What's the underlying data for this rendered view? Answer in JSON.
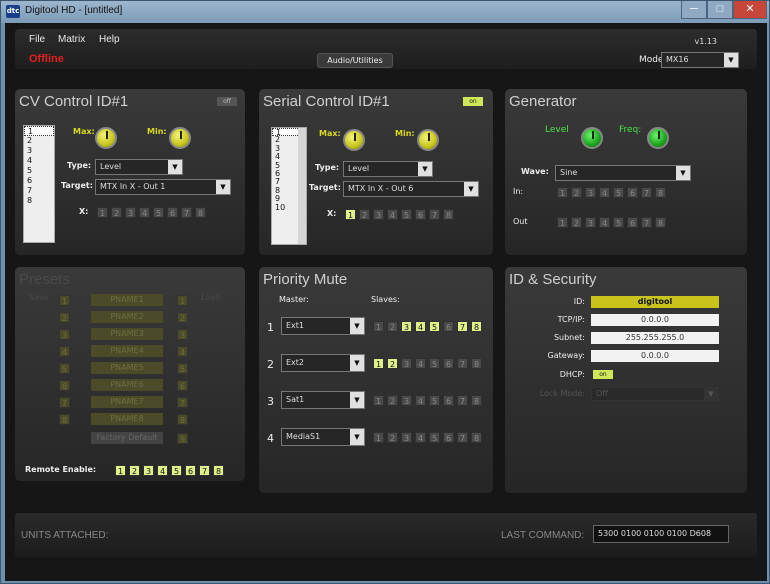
{
  "window": {
    "title": "Digitool HD - [untitled]",
    "app_icon": "dtc",
    "min": "─",
    "max": "□",
    "close": "✕"
  },
  "menu": {
    "file": "File",
    "matrix": "Matrix",
    "help": "Help",
    "version": "v1.13",
    "status": "Offline",
    "center_button": "Audio/Utilities",
    "model_label": "Model:",
    "model_value": "MX16"
  },
  "cv": {
    "title": "CV Control ID#1",
    "toggle": "off",
    "list": [
      "1",
      "2",
      "3",
      "4",
      "5",
      "6",
      "7",
      "8"
    ],
    "max": "Max:",
    "min": "Min:",
    "type_label": "Type:",
    "type_value": "Level",
    "target_label": "Target:",
    "target_value": "MTX In X - Out 1",
    "x_label": "X:",
    "x_buttons": [
      "1",
      "2",
      "3",
      "4",
      "5",
      "6",
      "7",
      "8"
    ]
  },
  "serial": {
    "title": "Serial Control ID#1",
    "toggle": "on",
    "list": [
      "1",
      "2",
      "3",
      "4",
      "5",
      "6",
      "7",
      "8",
      "9",
      "10"
    ],
    "max": "Max:",
    "min": "Min:",
    "type_label": "Type:",
    "type_value": "Level",
    "target_label": "Target:",
    "target_value": "MTX In X - Out 6",
    "x_label": "X:",
    "x_buttons": [
      "1",
      "2",
      "3",
      "4",
      "5",
      "6",
      "7",
      "8"
    ],
    "x_on": "1"
  },
  "gen": {
    "title": "Generator",
    "level": "Level",
    "freq": "Freq:",
    "wave_label": "Wave:",
    "wave_value": "Sine",
    "in_label": "In:",
    "out_label": "Out",
    "buttons": [
      "1",
      "2",
      "3",
      "4",
      "5",
      "6",
      "7",
      "8"
    ]
  },
  "presets": {
    "title": "Presets",
    "save": "Save",
    "load": "Load",
    "names": [
      "PNAME1",
      "PNAME2",
      "PNAME3",
      "PNAME4",
      "PNAME5",
      "PNAME6",
      "PNAME7",
      "PNAME8"
    ],
    "nums": [
      "1",
      "2",
      "3",
      "4",
      "5",
      "6",
      "7",
      "8"
    ],
    "factory": "Factory Default",
    "factory_num": "9",
    "remote_label": "Remote Enable:",
    "remote": [
      "1",
      "2",
      "3",
      "4",
      "5",
      "6",
      "7",
      "8"
    ]
  },
  "mute": {
    "title": "Priority Mute",
    "master": "Master:",
    "slaves": "Slaves:",
    "rows": [
      {
        "num": "1",
        "value": "Ext1",
        "on": [
          "3",
          "4",
          "5",
          "7",
          "8"
        ]
      },
      {
        "num": "2",
        "value": "Ext2",
        "on": [
          "1",
          "2"
        ]
      },
      {
        "num": "3",
        "value": "Sat1",
        "on": []
      },
      {
        "num": "4",
        "value": "MediaS1",
        "on": []
      }
    ],
    "buttons": [
      "1",
      "2",
      "3",
      "4",
      "5",
      "6",
      "7",
      "8"
    ]
  },
  "idsec": {
    "title": "ID & Security",
    "id_label": "ID:",
    "id": "digitool",
    "tcp_label": "TCP/IP:",
    "tcp": "0.0.0.0",
    "subnet_label": "Subnet:",
    "subnet": "255.255.255.0",
    "gateway_label": "Gateway:",
    "gateway": "0.0.0.0",
    "dhcp_label": "DHCP:",
    "dhcp": "on",
    "lock_label": "Lock Mode:",
    "lock": "Off"
  },
  "status": {
    "units": "UNITS ATTACHED:",
    "last_label": "LAST COMMAND:",
    "last": "5300 0100 0100 0100 D608"
  }
}
